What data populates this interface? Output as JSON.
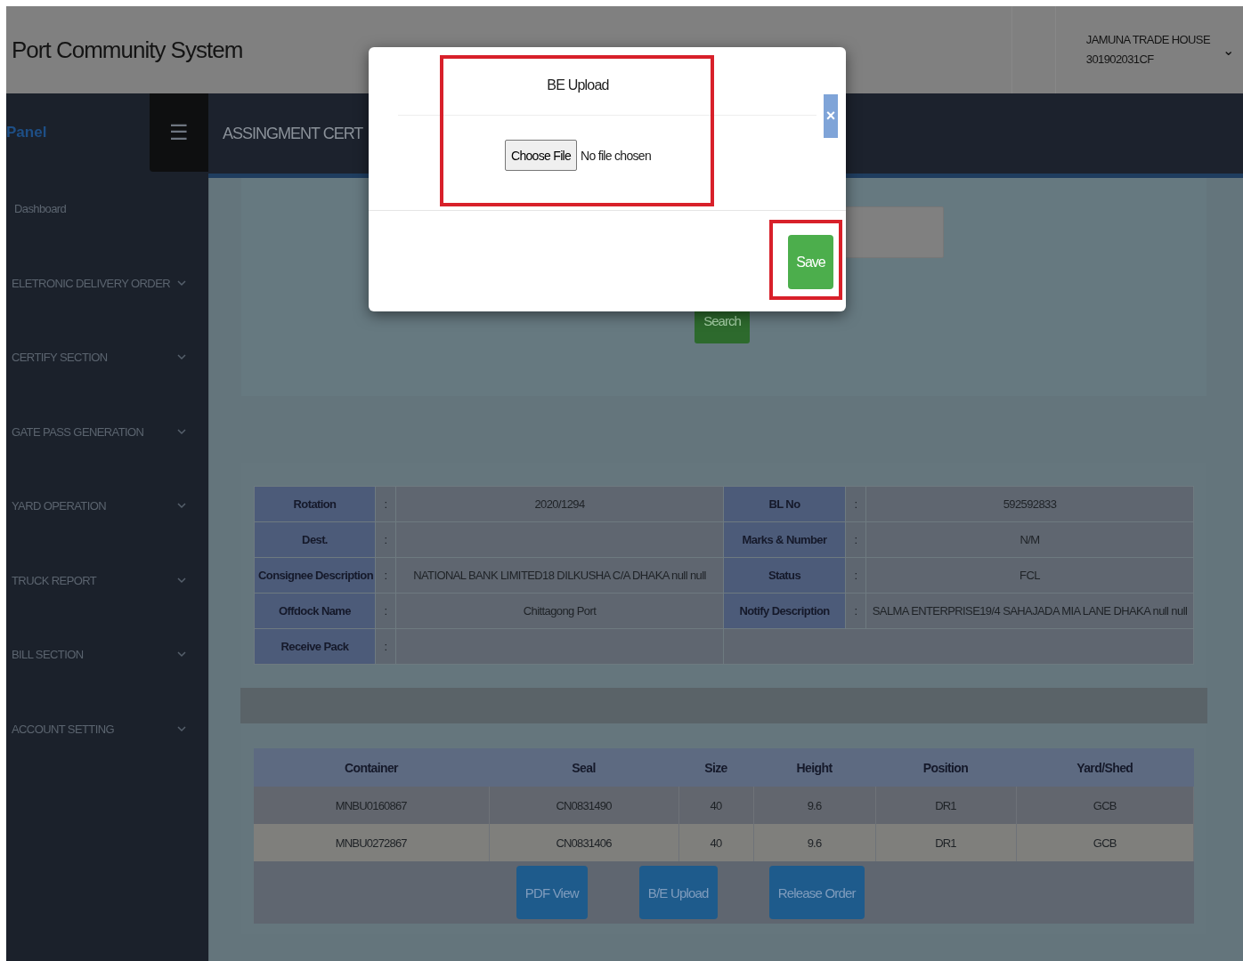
{
  "header": {
    "title": "Port Community System",
    "user_name": "JAMUNA TRADE HOUSE",
    "user_code": "301902031CF",
    "caret": "⌄"
  },
  "sidebar": {
    "panel_label": "Panel",
    "menu_icon": "☰",
    "items": [
      {
        "label": "Dashboard",
        "kind": "link"
      },
      {
        "label": "ELETRONIC DELIVERY ORDER",
        "kind": "group"
      },
      {
        "label": "CERTIFY SECTION",
        "kind": "group"
      },
      {
        "label": "GATE PASS GENERATION",
        "kind": "group"
      },
      {
        "label": "YARD OPERATION",
        "kind": "group"
      },
      {
        "label": "TRUCK REPORT",
        "kind": "group"
      },
      {
        "label": "BILL SECTION",
        "kind": "group"
      },
      {
        "label": "ACCOUNT SETTING",
        "kind": "group"
      }
    ]
  },
  "page_title": "ASSINGMENT CERT",
  "search": {
    "button": "Search"
  },
  "info": {
    "separator": ":",
    "rows": [
      {
        "left": {
          "label": "Rotation",
          "value": "2020/1294"
        },
        "right": {
          "label": "BL No",
          "value": "592592833"
        }
      },
      {
        "left": {
          "label": "Dest."
        },
        "right": {
          "label": "Marks & Number",
          "value": "N/M"
        }
      },
      {
        "left": {
          "label": "Consignee Description",
          "value": "NATIONAL BANK LIMITED18 DILKUSHA C/A DHAKA null null"
        },
        "right": {
          "label": "Status",
          "value": "FCL"
        }
      },
      {
        "left": {
          "label": "Offdock Name",
          "value": "Chittagong Port"
        },
        "right": {
          "label": "Notify Description",
          "value": "SALMA ENTERPRISE19/4 SAHAJADA MIA LANE DHAKA null null"
        }
      },
      {
        "left": {
          "label": "Receive Pack"
        }
      }
    ]
  },
  "containers": {
    "columns": [
      "Container",
      "Seal",
      "Size",
      "Height",
      "Position",
      "Yard/Shed"
    ],
    "rows": [
      [
        "MNBU0160867",
        "CN0831490",
        "40",
        "9.6",
        "DR1",
        "GCB"
      ],
      [
        "MNBU0272867",
        "CN0831406",
        "40",
        "9.6",
        "DR1",
        "GCB"
      ]
    ],
    "buttons": [
      "PDF View",
      "B/E Upload",
      "Release Order"
    ]
  },
  "modal": {
    "title": "BE Upload",
    "file_button": "Choose File",
    "file_status": "No file chosen",
    "close": "×",
    "save": "Save"
  }
}
